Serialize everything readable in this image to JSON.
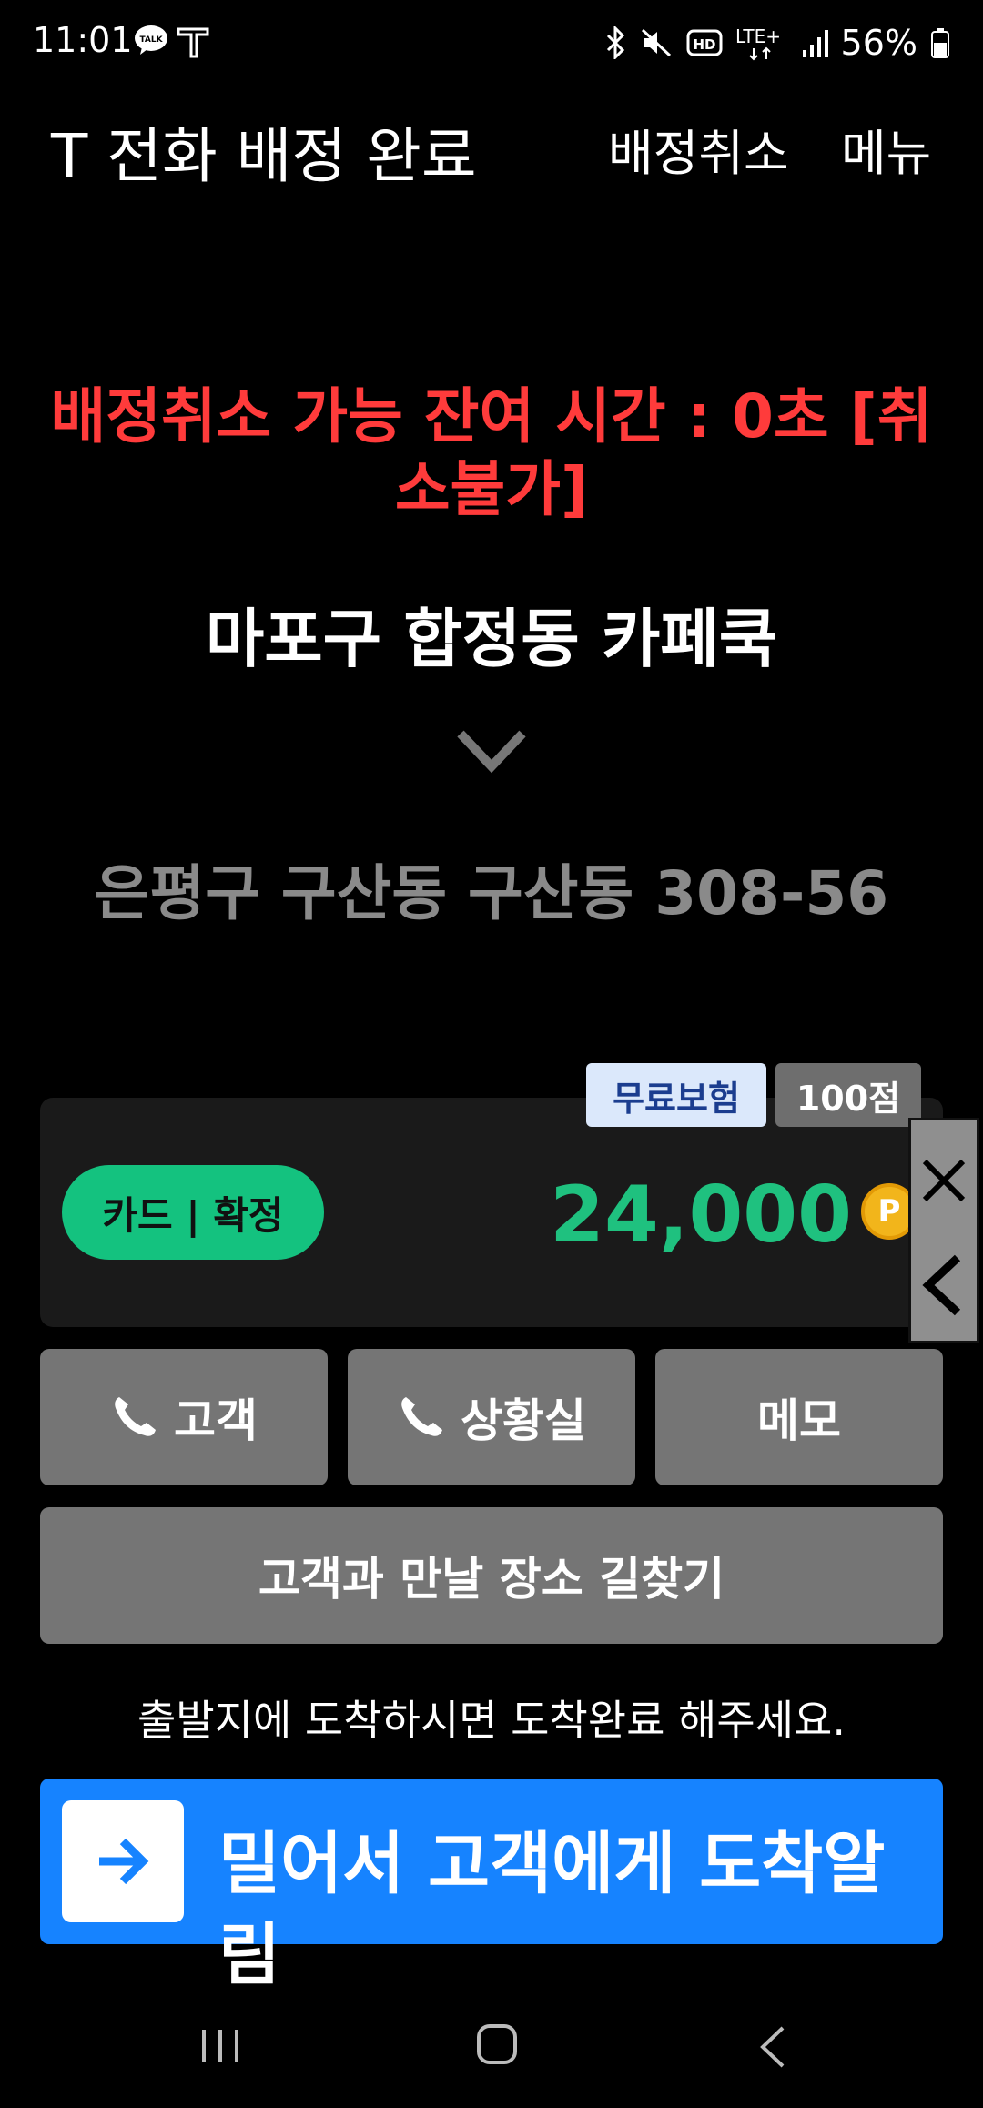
{
  "status_bar": {
    "time": "11:01",
    "battery_percent": "56%",
    "icons": [
      "kakaotalk-icon",
      "t-app-icon",
      "bluetooth-icon",
      "mute-icon",
      "hd-icon",
      "lte-icon",
      "signal-icon",
      "battery-icon"
    ],
    "network": "LTE+"
  },
  "header": {
    "title": "T 전화 배정 완료",
    "cancel_label": "배정취소",
    "menu_label": "메뉴"
  },
  "timer": {
    "text": "배정취소 가능 잔여 시간 : 0초 [취소불가]",
    "color": "#ff3b3b"
  },
  "route": {
    "origin": "마포구 합정동 카페쿡",
    "destination": "은평구 구산동 구산동 308-56"
  },
  "fare": {
    "insurance_tag": "무료보험",
    "points_tag": "100점",
    "payment_label": "카드 | 확정",
    "amount": "24,000",
    "point_icon_letter": "P",
    "accent_color": "#1fc17f"
  },
  "actions": {
    "customer_label": "고객",
    "control_label": "상황실",
    "memo_label": "메모",
    "navigate_label": "고객과 만날 장소 길찾기"
  },
  "hint": "출발지에 도착하시면 도착완료 해주세요.",
  "arrive": {
    "label": "밀어서 고객에게 도착알림",
    "color": "#1683ff"
  }
}
